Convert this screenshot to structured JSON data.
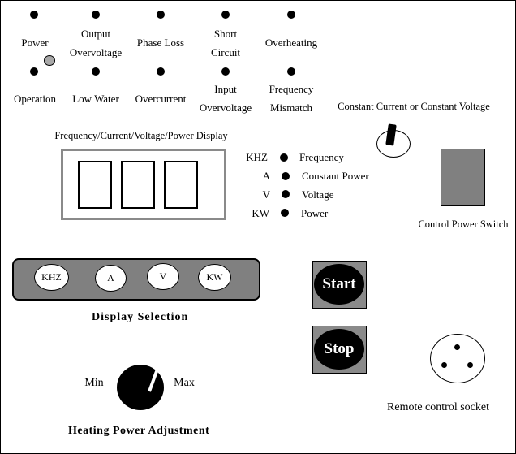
{
  "indicators_top": [
    {
      "label": "Power"
    },
    {
      "label_line1": "Output",
      "label_line2": "Overvoltage"
    },
    {
      "label": "Phase Loss"
    },
    {
      "label_line1": "Short",
      "label_line2": "Circuit"
    },
    {
      "label": "Overheating"
    }
  ],
  "indicators_bottom": [
    {
      "label": "Operation"
    },
    {
      "label": "Low Water"
    },
    {
      "label": "Overcurrent"
    },
    {
      "label_line1": "Input",
      "label_line2": "Overvoltage"
    },
    {
      "label_line1": "Frequency",
      "label_line2": "Mismatch"
    }
  ],
  "cc_cv_label": "Constant Current or Constant Voltage",
  "display_title": "Frequency/Current/Voltage/Power Display",
  "mode_indicators": [
    {
      "unit": "KHZ",
      "label": "Frequency"
    },
    {
      "unit": "A",
      "label": "Constant Power"
    },
    {
      "unit": "V",
      "label": "Voltage"
    },
    {
      "unit": "KW",
      "label": "Power"
    }
  ],
  "control_power_switch_label": "Control Power Switch",
  "display_selection": {
    "buttons": [
      "KHZ",
      "A",
      "V",
      "KW"
    ],
    "title": "Display Selection"
  },
  "start_label": "Start",
  "stop_label": "Stop",
  "heating": {
    "min_label": "Min",
    "max_label": "Max",
    "title": "Heating Power Adjustment"
  },
  "remote_socket_label": "Remote control socket",
  "colors": {
    "panel_gray": "#808080",
    "display_border": "#8a8a8a",
    "knob_gray": "#a8a8a8"
  }
}
